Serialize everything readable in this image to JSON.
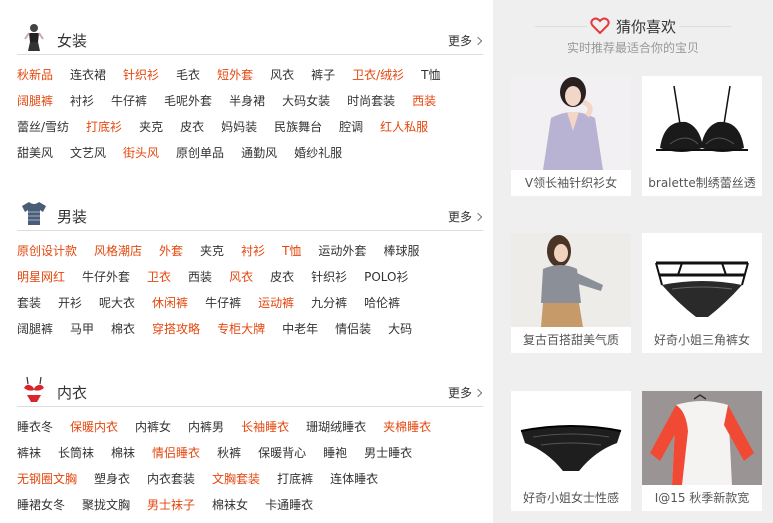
{
  "colors": {
    "accent": "#e4470f",
    "text": "#333333",
    "sidebar_bg": "#efefef"
  },
  "categories": [
    {
      "title": "女装",
      "icon": "woman-figure-icon",
      "more": "更多",
      "rows": [
        [
          {
            "t": "秋新品",
            "hot": true
          },
          {
            "t": "连衣裙"
          },
          {
            "t": "针织衫",
            "hot": true
          },
          {
            "t": "毛衣"
          },
          {
            "t": "短外套",
            "hot": true
          },
          {
            "t": "风衣"
          },
          {
            "t": "裤子"
          },
          {
            "t": "卫衣/绒衫",
            "hot": true
          },
          {
            "t": "T恤"
          }
        ],
        [
          {
            "t": "阔腿裤",
            "hot": true
          },
          {
            "t": "衬衫"
          },
          {
            "t": "牛仔裤"
          },
          {
            "t": "毛呢外套"
          },
          {
            "t": "半身裙"
          },
          {
            "t": "大码女装"
          },
          {
            "t": "时尚套装"
          },
          {
            "t": "西装",
            "hot": true
          }
        ],
        [
          {
            "t": "蕾丝/雪纺"
          },
          {
            "t": "打底衫",
            "hot": true
          },
          {
            "t": "夹克"
          },
          {
            "t": "皮衣"
          },
          {
            "t": "妈妈装"
          },
          {
            "t": "民族舞台"
          },
          {
            "t": "腔调"
          },
          {
            "t": "红人私服",
            "hot": true
          }
        ],
        [
          {
            "t": "甜美风"
          },
          {
            "t": "文艺风"
          },
          {
            "t": "街头风",
            "hot": true
          },
          {
            "t": "原创单品"
          },
          {
            "t": "通勤风"
          },
          {
            "t": "婚纱礼服"
          }
        ]
      ]
    },
    {
      "title": "男装",
      "icon": "tshirt-icon",
      "more": "更多",
      "rows": [
        [
          {
            "t": "原创设计款",
            "hot": true
          },
          {
            "t": "风格潮店",
            "hot": true
          },
          {
            "t": "外套",
            "hot": true
          },
          {
            "t": "夹克"
          },
          {
            "t": "衬衫",
            "hot": true
          },
          {
            "t": "T恤",
            "hot": true
          },
          {
            "t": "运动外套"
          },
          {
            "t": "棒球服"
          }
        ],
        [
          {
            "t": "明星网红",
            "hot": true
          },
          {
            "t": "牛仔外套"
          },
          {
            "t": "卫衣",
            "hot": true
          },
          {
            "t": "西装"
          },
          {
            "t": "风衣",
            "hot": true
          },
          {
            "t": "皮衣"
          },
          {
            "t": "针织衫"
          },
          {
            "t": "POLO衫"
          }
        ],
        [
          {
            "t": "套装"
          },
          {
            "t": "开衫"
          },
          {
            "t": "呢大衣"
          },
          {
            "t": "休闲裤",
            "hot": true
          },
          {
            "t": "牛仔裤"
          },
          {
            "t": "运动裤",
            "hot": true
          },
          {
            "t": "九分裤"
          },
          {
            "t": "哈伦裤"
          }
        ],
        [
          {
            "t": "阔腿裤"
          },
          {
            "t": "马甲"
          },
          {
            "t": "棉衣"
          },
          {
            "t": "穿搭攻略",
            "hot": true
          },
          {
            "t": "专柜大牌",
            "hot": true
          },
          {
            "t": "中老年"
          },
          {
            "t": "情侣装"
          },
          {
            "t": "大码"
          }
        ]
      ]
    },
    {
      "title": "内衣",
      "icon": "bra-icon",
      "more": "更多",
      "rows": [
        [
          {
            "t": "睡衣冬"
          },
          {
            "t": "保暖内衣",
            "hot": true
          },
          {
            "t": "内裤女"
          },
          {
            "t": "内裤男"
          },
          {
            "t": "长袖睡衣",
            "hot": true
          },
          {
            "t": "珊瑚绒睡衣"
          },
          {
            "t": "夹棉睡衣",
            "hot": true
          }
        ],
        [
          {
            "t": "裤袜"
          },
          {
            "t": "长筒袜"
          },
          {
            "t": "棉袜"
          },
          {
            "t": "情侣睡衣",
            "hot": true
          },
          {
            "t": "秋裤"
          },
          {
            "t": "保暖背心"
          },
          {
            "t": "睡袍"
          },
          {
            "t": "男士睡衣"
          }
        ],
        [
          {
            "t": "无钢圈文胸",
            "hot": true
          },
          {
            "t": "塑身衣"
          },
          {
            "t": "内衣套装"
          },
          {
            "t": "文胸套装",
            "hot": true
          },
          {
            "t": "打底裤"
          },
          {
            "t": "连体睡衣"
          }
        ],
        [
          {
            "t": "睡裙女冬"
          },
          {
            "t": "聚拢文胸"
          },
          {
            "t": "男士袜子",
            "hot": true
          },
          {
            "t": "棉袜女"
          },
          {
            "t": "卡通睡衣"
          }
        ]
      ]
    }
  ],
  "recommend": {
    "title": "猜你喜欢",
    "title_icon": "heart-icon",
    "subtitle": "实时推荐最适合你的宝贝",
    "items": [
      {
        "caption": "V领长袖针织衫女",
        "image": "model-cardigan-photo"
      },
      {
        "caption": "bralette制绣蕾丝透",
        "image": "black-lace-bra-photo"
      },
      {
        "caption": "复古百搭甜美气质",
        "image": "model-grey-sweater-photo"
      },
      {
        "caption": "好奇小姐三角裤女",
        "image": "black-strappy-panty-photo"
      },
      {
        "caption": "好奇小姐女士性感",
        "image": "black-lace-panty-photo"
      },
      {
        "caption": "I@15 秋季新款宽",
        "image": "red-white-shirt-photo"
      }
    ]
  }
}
